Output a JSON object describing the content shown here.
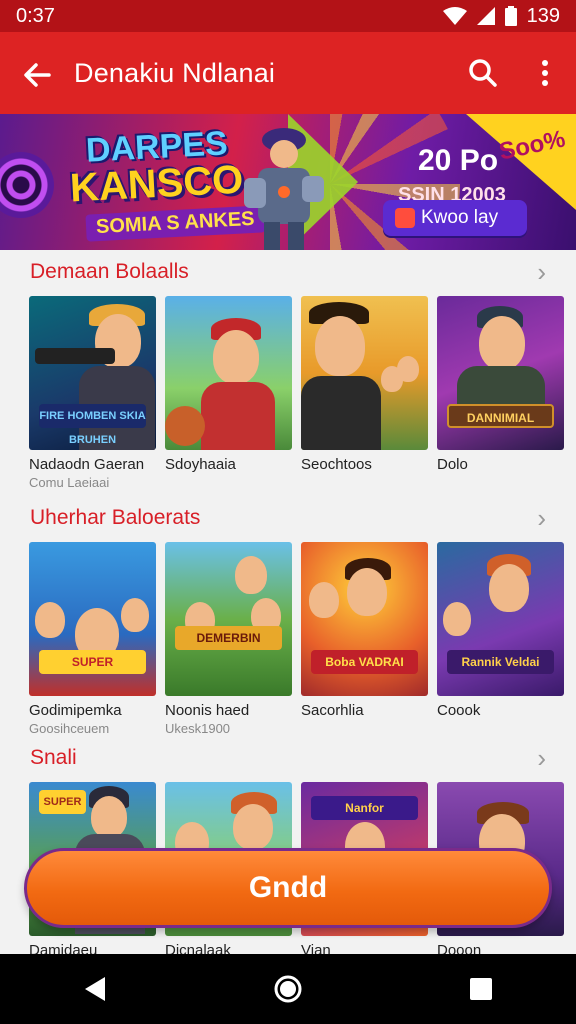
{
  "status_bar": {
    "time": "0:37",
    "battery": "139"
  },
  "app_bar": {
    "title": "Denakiu Ndlanai"
  },
  "banner": {
    "logo_line1": "DARPES",
    "logo_line2": "KANSCO",
    "logo_line3": "SOMIA S ANKES",
    "offer_line1": "20 Po",
    "offer_line2": "SSIN 12003",
    "corner_text": "Soo%",
    "button_label": "Kwoo lay"
  },
  "sections": [
    {
      "title": "Demaan Bolaalls",
      "items": [
        {
          "title": "Nadaodn Gaeran",
          "subtitle": "Comu Laeiaai"
        },
        {
          "title": "Sdoyhaaia",
          "subtitle": ""
        },
        {
          "title": "Seochtoos",
          "subtitle": ""
        },
        {
          "title": "Dolo",
          "subtitle": ""
        }
      ]
    },
    {
      "title": "Uherhar Baloerats",
      "items": [
        {
          "title": "Godimipemka",
          "subtitle": "Goosihceuem"
        },
        {
          "title": "Noonis haed",
          "subtitle": "Ukesk1900"
        },
        {
          "title": "Sacorhlia",
          "subtitle": ""
        },
        {
          "title": "Coook",
          "subtitle": ""
        }
      ]
    },
    {
      "title": "Snali",
      "items": [
        {
          "title": "Damidaeu",
          "subtitle": ""
        },
        {
          "title": "Dicnalaak",
          "subtitle": ""
        },
        {
          "title": "Vian",
          "subtitle": ""
        },
        {
          "title": "Dooon",
          "subtitle": ""
        }
      ]
    }
  ],
  "thumb_labels": [
    "FIRE HOMBEN SKIA BRUHEN",
    "",
    "",
    "DANNIMIAL",
    "SUPER",
    "DEMERBIN",
    "Boba VADRAI",
    "Rannik Veldai",
    "SUPER",
    "",
    "Nanfor",
    ""
  ],
  "fab": {
    "label": "Gndd"
  },
  "colors": {
    "primary": "#dd2323",
    "status_bar": "#b31217",
    "accent": "#f26a12",
    "section_title": "#d81f27"
  }
}
